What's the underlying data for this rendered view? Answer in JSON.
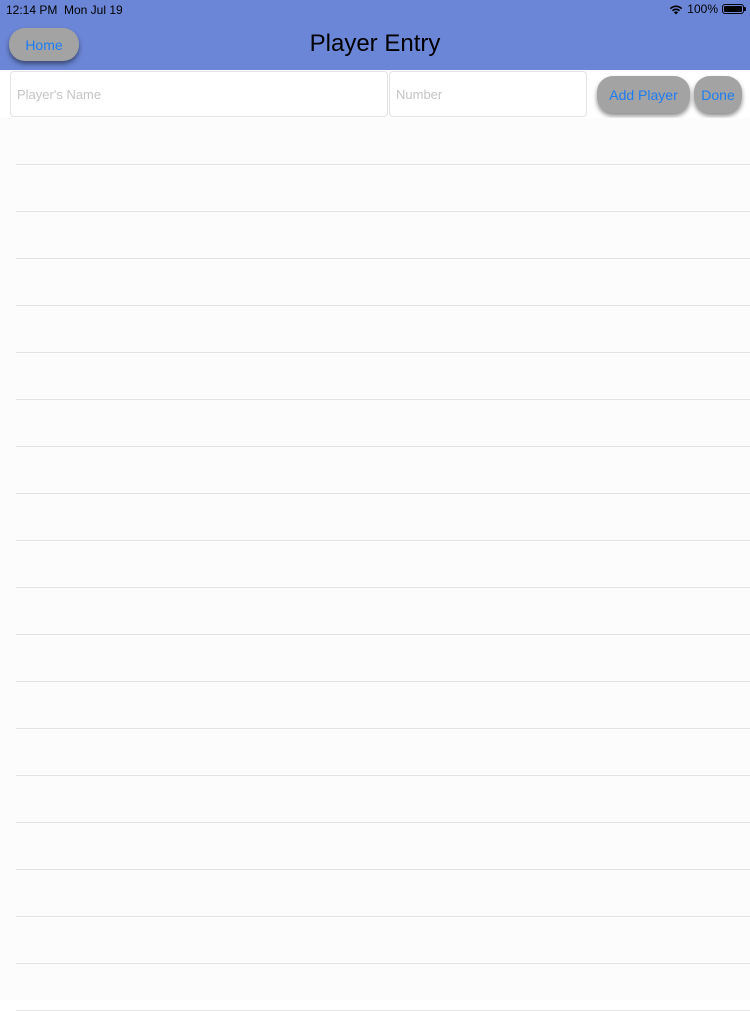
{
  "status_bar": {
    "time": "12:14 PM",
    "date": "Mon Jul 19",
    "battery": "100%",
    "icons": [
      "wifi-icon",
      "battery-icon"
    ]
  },
  "header": {
    "title": "Player Entry",
    "home_label": "Home",
    "background_color": "#6b86d6"
  },
  "entry_form": {
    "name_value": "",
    "name_placeholder": "Player's Name",
    "number_value": "",
    "number_placeholder": "Number",
    "add_label": "Add Player",
    "done_label": "Done",
    "button_text_color": "#1e7cf2"
  },
  "player_list": {
    "rows": []
  }
}
